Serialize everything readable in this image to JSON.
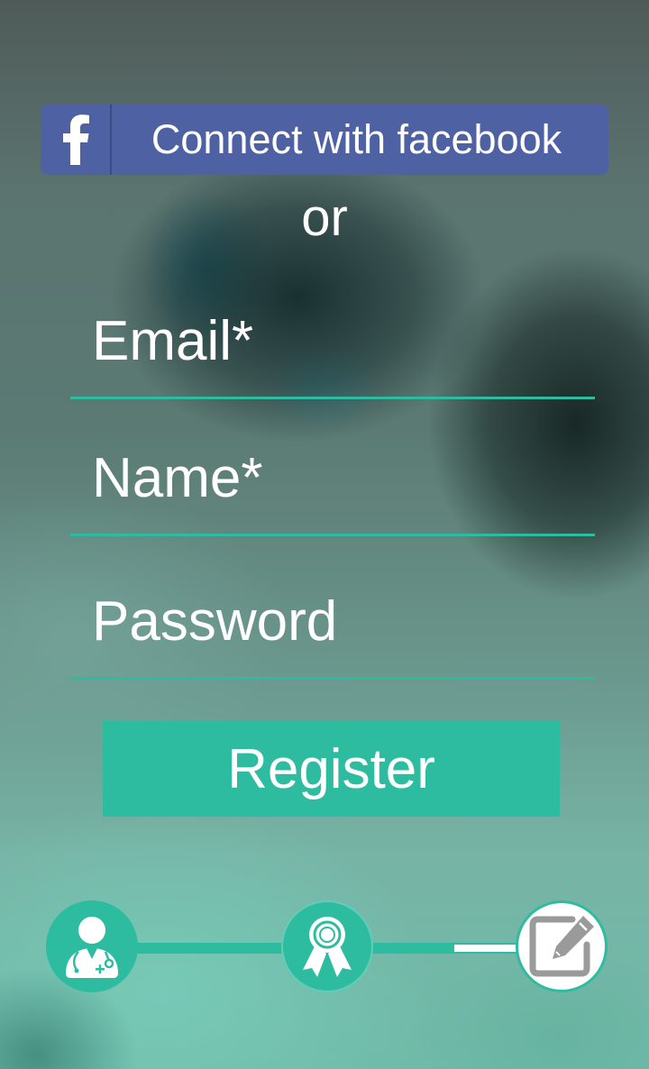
{
  "facebook": {
    "label": "Connect with facebook",
    "logo": "f",
    "icon": "facebook-icon",
    "color": "#4e62a3"
  },
  "separator": {
    "text": "or"
  },
  "form": {
    "email_placeholder": "Email*",
    "name_placeholder": "Name*",
    "password_placeholder": "Password",
    "register_label": "Register"
  },
  "progress": {
    "steps": [
      {
        "icon": "doctor-icon",
        "state": "completed"
      },
      {
        "icon": "award-ribbon-icon",
        "state": "completed"
      },
      {
        "icon": "edit-icon",
        "state": "current"
      }
    ],
    "current_step": 3,
    "total_steps": 3
  },
  "colors": {
    "accent": "#2ebca0",
    "facebook": "#4e62a3",
    "text": "#ffffff"
  }
}
